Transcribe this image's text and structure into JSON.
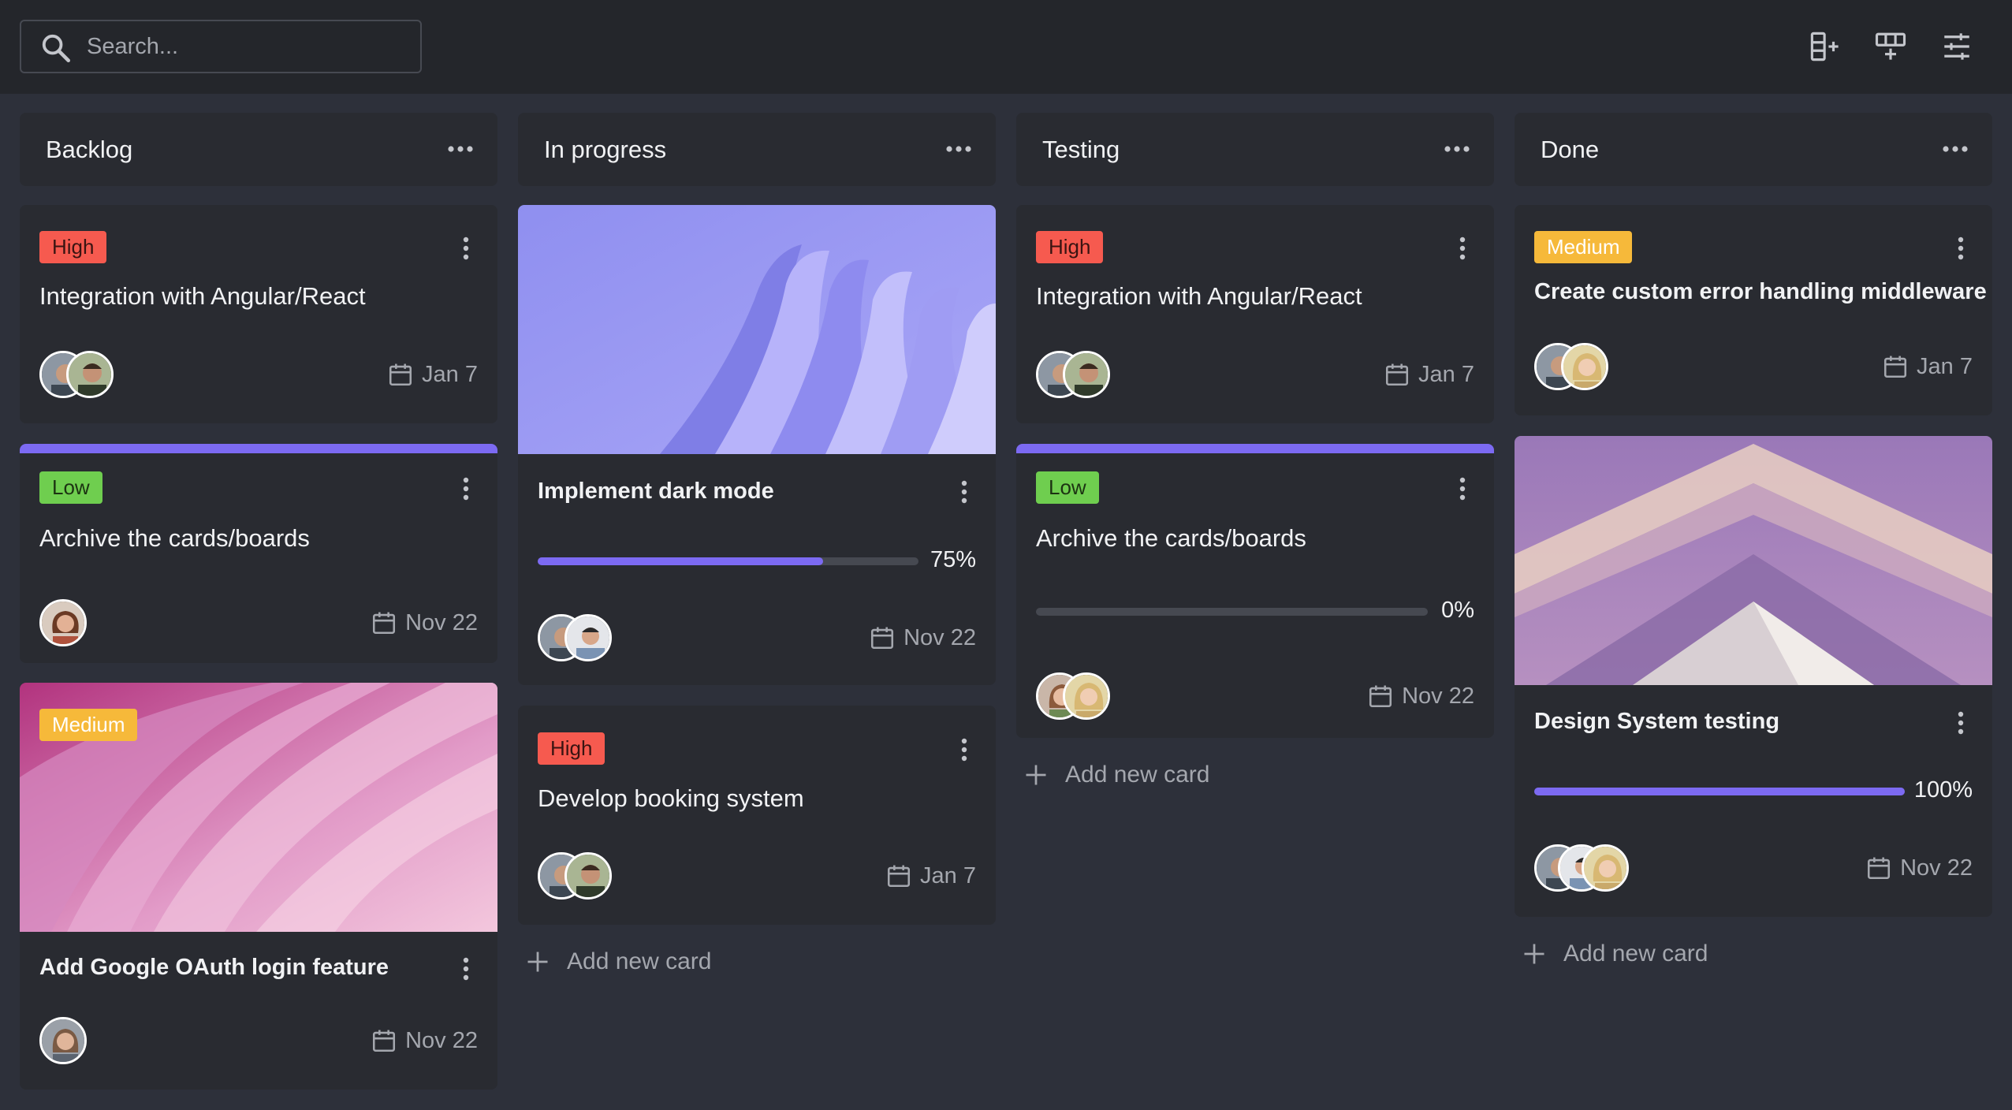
{
  "search": {
    "placeholder": "Search..."
  },
  "toolbar": {
    "icons": [
      "add-column-icon",
      "add-row-icon",
      "filter-sliders-icon"
    ]
  },
  "columns": [
    {
      "title": "Backlog",
      "cards": [
        {
          "badge": "High",
          "title": "Integration with Angular/React",
          "date": "Jan 7"
        },
        {
          "badge": "Low",
          "title": "Archive the cards/boards",
          "date": "Nov 22"
        },
        {
          "badge": "Medium",
          "title": "Add Google OAuth login feature",
          "date": "Nov 22"
        }
      ]
    },
    {
      "title": "In progress",
      "cards": [
        {
          "title": "Implement dark mode",
          "progress": 75,
          "progress_label": "75%",
          "date": "Nov 22"
        },
        {
          "badge": "High",
          "title": "Develop booking system",
          "date": "Jan 7"
        }
      ],
      "add_label": "Add new card"
    },
    {
      "title": "Testing",
      "cards": [
        {
          "badge": "High",
          "title": "Integration with Angular/React",
          "date": "Jan 7"
        },
        {
          "badge": "Low",
          "title": "Archive the cards/boards",
          "progress": 0,
          "progress_label": "0%",
          "date": "Nov 22"
        }
      ],
      "add_label": "Add new card"
    },
    {
      "title": "Done",
      "cards": [
        {
          "badge": "Medium",
          "title": "Create custom error handling middleware",
          "date": "Jan 7"
        },
        {
          "title": "Design System testing",
          "progress": 100,
          "progress_label": "100%",
          "date": "Nov 22"
        }
      ],
      "add_label": "Add new card"
    }
  ],
  "colors": {
    "accent": "#7c6af2",
    "high": "#f65a4f",
    "low": "#6fce4f",
    "medium": "#f6b93a",
    "card": "#292b31",
    "board": "#2d303a"
  }
}
